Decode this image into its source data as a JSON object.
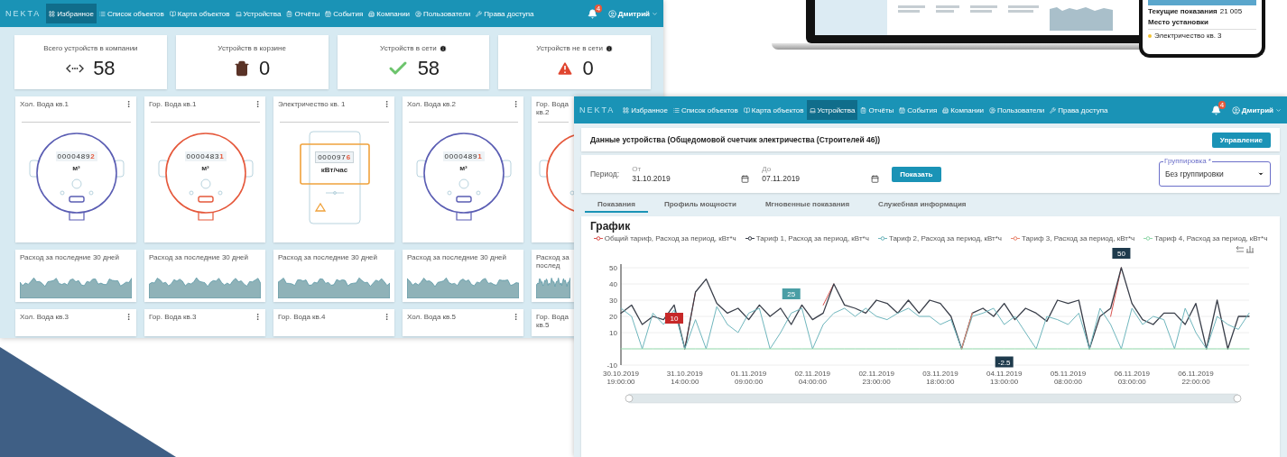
{
  "left_window": {
    "logo": "NEKTA",
    "nav": [
      {
        "label": "Избранное",
        "selected": true
      },
      {
        "label": "Список объектов",
        "selected": false
      },
      {
        "label": "Карта объектов",
        "selected": false
      },
      {
        "label": "Устройства",
        "selected": false
      },
      {
        "label": "Отчёты",
        "selected": false
      },
      {
        "label": "События",
        "selected": false
      },
      {
        "label": "Компании",
        "selected": false
      },
      {
        "label": "Пользователи",
        "selected": false
      },
      {
        "label": "Права доступа",
        "selected": false
      }
    ],
    "notifications": "4",
    "user": "Дмитрий",
    "stats": [
      {
        "kind": "total",
        "label": "Всего устройств в компании",
        "info": false,
        "value": "58"
      },
      {
        "kind": "trash",
        "label": "Устройств в корзине",
        "info": false,
        "value": "0"
      },
      {
        "kind": "online",
        "label": "Устройств в сети",
        "info": true,
        "value": "58"
      },
      {
        "kind": "offline",
        "label": "Устройств не в сети",
        "info": true,
        "value": "0"
      }
    ],
    "devices": [
      {
        "title": "Хол. Вода кв.1",
        "kind": "water",
        "color": "#5a5db3",
        "reading": "00004892",
        "unit": "м³",
        "menu": true,
        "spark_label": "Расход за последние 30 дней"
      },
      {
        "title": "Гор. Вода кв.1",
        "kind": "water",
        "color": "#e5583b",
        "reading": "00004831",
        "unit": "м³",
        "menu": true,
        "spark_label": "Расход за последние 30 дней"
      },
      {
        "title": "Электричество кв. 1",
        "kind": "electric",
        "color": "#f0a23c",
        "reading": "0000976",
        "unit": "кВт/час",
        "menu": true,
        "spark_label": "Расход за последние 30 дней"
      },
      {
        "title": "Хол. Вода кв.2",
        "kind": "water",
        "color": "#5a5db3",
        "reading": "00004891",
        "unit": "м³",
        "menu": true,
        "spark_label": "Расход за последние 30 дней"
      },
      {
        "title": "Гор. Вода кв.2",
        "kind": "water",
        "color": "#e5583b",
        "menu": false,
        "spark_label": "Расход за послед"
      }
    ],
    "more_devices": [
      {
        "title": "Хол. Вода кв.3",
        "menu": true
      },
      {
        "title": "Гор. Вода кв.3",
        "menu": true
      },
      {
        "title": "Гор. Вода кв.4",
        "menu": true
      },
      {
        "title": "Хол. Вода кв.5",
        "menu": true
      },
      {
        "title": "Гор. Вода кв.5",
        "menu": false
      }
    ]
  },
  "right_window": {
    "logo": "NEKTA",
    "nav": [
      {
        "label": "Избранное",
        "selected": false
      },
      {
        "label": "Список объектов",
        "selected": false
      },
      {
        "label": "Карта объектов",
        "selected": false
      },
      {
        "label": "Устройства",
        "selected": true
      },
      {
        "label": "Отчёты",
        "selected": false
      },
      {
        "label": "События",
        "selected": false
      },
      {
        "label": "Компании",
        "selected": false
      },
      {
        "label": "Пользователи",
        "selected": false
      },
      {
        "label": "Права доступа",
        "selected": false
      }
    ],
    "notifications": "4",
    "user": "Дмитрий",
    "title": "Данные устройства (Общедомовой счетчик электричества (Строителей 46))",
    "manage_button": "Управление",
    "period_label": "Период:",
    "from": {
      "label": "От",
      "value": "31.10.2019"
    },
    "to": {
      "label": "До",
      "value": "07.11.2019"
    },
    "show_button": "Показать",
    "grouping": {
      "label": "Группировка *",
      "value": "Без группировки"
    },
    "tabs": [
      {
        "label": "Показания",
        "selected": true
      },
      {
        "label": "Профиль мощности",
        "selected": false
      },
      {
        "label": "Мгновенные показания",
        "selected": false
      },
      {
        "label": "Служебная информация",
        "selected": false
      }
    ],
    "chart_title": "График",
    "chart_data": {
      "type": "line",
      "categories": [
        "30.10.2019 19:00:00",
        null,
        null,
        null,
        null,
        null,
        "31.10.2019 14:00:00",
        null,
        null,
        null,
        null,
        null,
        "01.11.2019 09:00:00",
        null,
        null,
        null,
        null,
        null,
        "02.11.2019 04:00:00",
        null,
        null,
        null,
        null,
        null,
        "02.11.2019 23:00:00",
        null,
        null,
        null,
        null,
        null,
        "03.11.2019 18:00:00",
        null,
        null,
        null,
        null,
        null,
        "04.11.2019 13:00:00",
        null,
        null,
        null,
        null,
        null,
        "05.11.2019 08:00:00",
        null,
        null,
        null,
        null,
        null,
        "06.11.2019 03:00:00",
        null,
        null,
        null,
        null,
        null,
        "06.11.2019 22:00:00",
        null,
        null,
        null,
        null,
        null
      ],
      "series": [
        {
          "name": "Общий тариф, Расход за период, кВт*ч",
          "color": "#d9534f",
          "values": [
            null,
            null,
            null,
            null,
            null,
            null,
            0,
            35,
            null,
            null,
            null,
            null,
            null,
            null,
            null,
            null,
            null,
            null,
            null,
            27,
            40,
            null,
            null,
            null,
            null,
            null,
            null,
            null,
            null,
            null,
            null,
            null,
            null,
            null,
            null,
            null,
            null,
            null,
            null,
            null,
            null,
            null,
            null,
            null,
            null,
            null,
            20,
            50,
            null,
            null,
            null,
            null,
            null,
            null,
            null,
            null,
            null,
            null,
            null,
            null
          ]
        },
        {
          "name": "Тариф 1, Расход за период, кВт*ч",
          "color": "#3a3f4a",
          "values": [
            22,
            27,
            15,
            20,
            18,
            27,
            0,
            35,
            43,
            28,
            22,
            25,
            18,
            27,
            20,
            25,
            15,
            27,
            18,
            22,
            40,
            27,
            25,
            22,
            30,
            28,
            22,
            30,
            22,
            30,
            28,
            20,
            0,
            22,
            25,
            20,
            28,
            18,
            25,
            22,
            17,
            30,
            28,
            30,
            0,
            20,
            25,
            50,
            28,
            18,
            15,
            22,
            22,
            15,
            28,
            0,
            30,
            0,
            20,
            20
          ]
        },
        {
          "name": "Тариф 2, Расход за период, кВт*ч",
          "color": "#6fb6bd",
          "values": [
            25,
            20,
            0,
            22,
            15,
            24,
            0,
            18,
            0,
            26,
            15,
            10,
            22,
            25,
            0,
            10,
            22,
            25,
            0,
            15,
            22,
            25,
            20,
            25,
            20,
            18,
            22,
            25,
            20,
            20,
            15,
            18,
            0,
            20,
            22,
            25,
            15,
            20,
            10,
            0,
            20,
            18,
            15,
            22,
            0,
            25,
            15,
            0,
            25,
            15,
            20,
            18,
            0,
            25,
            10,
            0,
            20,
            15,
            12,
            22
          ]
        },
        {
          "name": "Тариф 3, Расход за период, кВт*ч",
          "color": "#e8866f",
          "values": [
            null,
            null,
            null,
            null,
            null,
            null,
            null,
            null,
            null,
            null,
            null,
            null,
            null,
            null,
            null,
            null,
            null,
            null,
            null,
            null,
            null,
            null,
            null,
            null,
            null,
            null,
            null,
            null,
            null,
            null,
            null,
            null,
            0,
            22,
            null,
            null,
            null,
            null,
            null,
            null,
            null,
            null,
            null,
            null,
            null,
            null,
            null,
            null,
            null,
            null,
            null,
            null,
            null,
            null,
            null,
            null,
            null,
            null,
            null,
            null
          ]
        },
        {
          "name": "Тариф 4, Расход за период, кВт*ч",
          "color": "#8fd6a8",
          "values": [
            0,
            0,
            0,
            0,
            0,
            0,
            0,
            0,
            0,
            0,
            0,
            0,
            0,
            0,
            0,
            0,
            0,
            0,
            0,
            0,
            0,
            0,
            0,
            0,
            0,
            0,
            0,
            0,
            0,
            0,
            0,
            0,
            0,
            0,
            0,
            0,
            0,
            0,
            0,
            0,
            0,
            0,
            0,
            0,
            0,
            0,
            0,
            0,
            0,
            0,
            0,
            0,
            0,
            0,
            0,
            0,
            0,
            0,
            0,
            0
          ]
        }
      ],
      "ylim": [
        -10,
        50
      ],
      "yticks": [
        -10,
        10,
        20,
        30,
        40,
        50
      ],
      "grid": true,
      "annotations": [
        "50",
        "10",
        "25",
        "-2.5"
      ]
    }
  },
  "phone": {
    "reading_label": "Текущие показания",
    "reading": "21 005",
    "place_label": "Место установки",
    "device": "Электричество кв. 3"
  }
}
